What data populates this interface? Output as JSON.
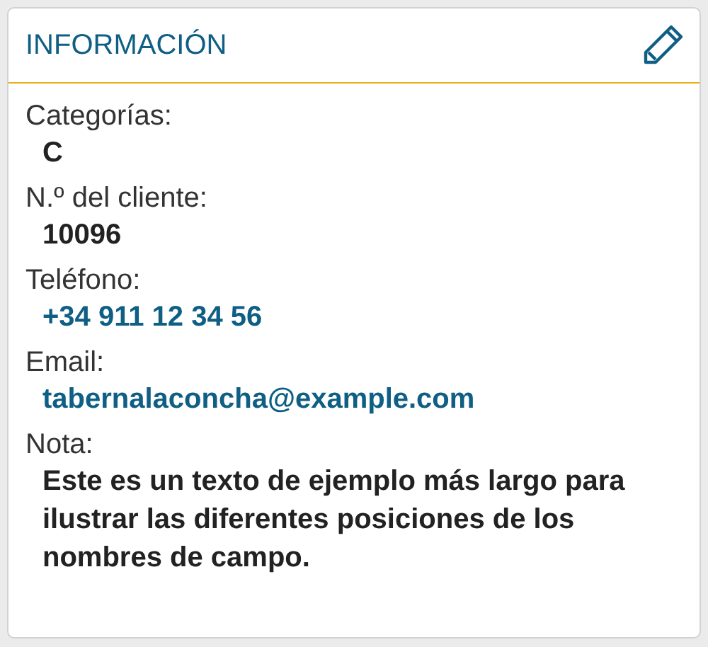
{
  "card": {
    "title": "INFORMACIÓN",
    "fields": [
      {
        "label": "Categorías:",
        "value": "C",
        "kind": "text"
      },
      {
        "label": "N.º del cliente:",
        "value": "10096",
        "kind": "text"
      },
      {
        "label": "Teléfono:",
        "value": "+34 911 12 34 56",
        "kind": "link"
      },
      {
        "label": "Email:",
        "value": "tabernalaconcha@example.com",
        "kind": "link"
      },
      {
        "label": "Nota:",
        "value": "Este es un texto de ejemplo más largo para ilustrar las diferentes posiciones de los nombres de campo.",
        "kind": "text"
      }
    ]
  }
}
